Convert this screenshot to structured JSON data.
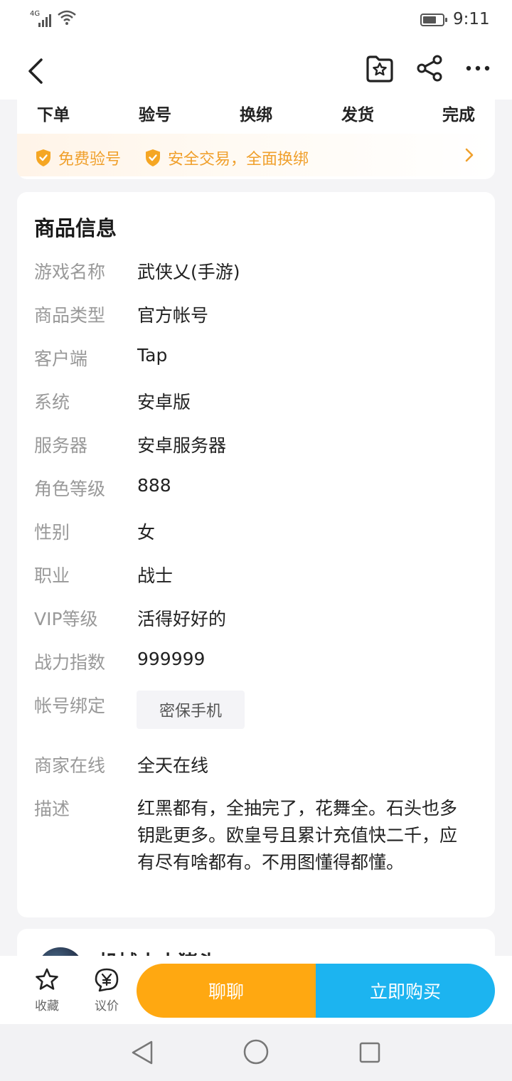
{
  "status": {
    "network": "4G",
    "time": "9:11"
  },
  "nav": {
    "back_icon": "back-chevron-icon",
    "favorite_icon": "star-folder-icon",
    "share_icon": "share-icon",
    "more_icon": "more-dots-icon"
  },
  "process": {
    "steps": [
      "下单",
      "验号",
      "换绑",
      "发货",
      "完成"
    ],
    "guarantees": [
      "免费验号",
      "安全交易，全面换绑"
    ],
    "accent": "#f0a02c"
  },
  "product": {
    "section_title": "商品信息",
    "rows": [
      {
        "label": "游戏名称",
        "value": "武侠乂(手游)"
      },
      {
        "label": "商品类型",
        "value": "官方帐号"
      },
      {
        "label": "客户端",
        "value": "Tap"
      },
      {
        "label": "系统",
        "value": "安卓版"
      },
      {
        "label": "服务器",
        "value": "安卓服务器"
      },
      {
        "label": "角色等级",
        "value": "888"
      },
      {
        "label": "性别",
        "value": "女"
      },
      {
        "label": "职业",
        "value": "战士"
      },
      {
        "label": "VIP等级",
        "value": "活得好好的"
      },
      {
        "label": "战力指数",
        "value": "999999"
      },
      {
        "label": "帐号绑定",
        "tag": "密保手机"
      },
      {
        "label": "商家在线",
        "value": "全天在线"
      },
      {
        "label": "描述",
        "value": "红黑都有，全抽完了，花舞全。石头也多钥匙更多。欧皇号且累计充值快二千，应有尽有啥都有。不用图懂得都懂。"
      }
    ]
  },
  "seller": {
    "name": "机械小小猪头"
  },
  "actions": {
    "favorite_label": "收藏",
    "bargain_label": "议价",
    "chat_label": "聊聊",
    "buy_label": "立即购买",
    "chat_color": "#ffa811",
    "buy_color": "#1cb4f0"
  }
}
